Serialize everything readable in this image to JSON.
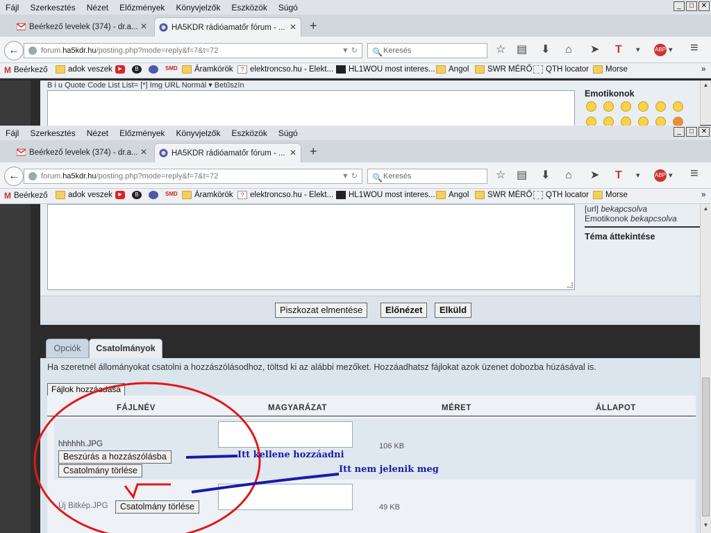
{
  "menubar": {
    "items": [
      "Fájl",
      "Szerkesztés",
      "Nézet",
      "Előzmények",
      "Könyvjelzők",
      "Eszközök",
      "Súgó"
    ]
  },
  "window_controls": [
    "_",
    "□",
    "✕"
  ],
  "tabs": [
    {
      "label": "Beérkező levelek (374) - dr.a...",
      "icon": "gmail-icon"
    },
    {
      "label": "HA5KDR rádióamatőr fórum - ...",
      "icon": "ha5kdr-icon"
    }
  ],
  "tab_close": "✕",
  "new_tab": "+",
  "nav": {
    "back": "←",
    "url_domain": "ha5kdr.hu",
    "url_prefix": "forum.",
    "url_path": "/posting.php?mode=reply&f=7&t=72",
    "search_placeholder": "Keresés",
    "url_arrows": "▼ ↻",
    "search_glyph": "🔍"
  },
  "toolbar_icons": {
    "star": "☆",
    "reader": "▤",
    "download": "⬇",
    "home": "⌂",
    "send": "➤",
    "t": "T",
    "t_arrow": "▾",
    "abp": "ABP",
    "abp_arrow": "▾",
    "menu": "≡"
  },
  "bookmarks": [
    {
      "label": "Beérkező",
      "icon": "gmail"
    },
    {
      "label": "adok veszek",
      "icon": "folder"
    },
    {
      "label": "",
      "icon": "youtube"
    },
    {
      "label": "",
      "icon": "b"
    },
    {
      "label": "",
      "icon": "ha5kdr"
    },
    {
      "label": "",
      "icon": "smd"
    },
    {
      "label": "Áramkörök",
      "icon": "folder"
    },
    {
      "label": "elektroncso.hu - Elekt...",
      "icon": "page"
    },
    {
      "label": "HL1WOU most interes...",
      "icon": "film"
    },
    {
      "label": "Angol",
      "icon": "folder"
    },
    {
      "label": "SWR MÉRŐ",
      "icon": "folder"
    },
    {
      "label": "QTH locator",
      "icon": "blank"
    },
    {
      "label": "Morse",
      "icon": "folder"
    }
  ],
  "bookmarks_more": "»",
  "bookmark_glyphs": {
    "gmail": "M",
    "youtube": "▶",
    "b": "B",
    "smd": "SMD",
    "page": "?"
  },
  "upper_editor": {
    "toolbar": "B  i  u  Quote  Code  List  List=  [*]  Img  URL  Normál ▾  Betűszín",
    "emoticons_title": "Emotikonok"
  },
  "sidebar": {
    "url_prefix": "[url] ",
    "url_status": "bekapcsolva",
    "emoti_prefix": "Emotikonok ",
    "emoti_status": "bekapcsolva",
    "topic_overview": "Téma áttekintése"
  },
  "buttons": {
    "draft": "Piszkozat elmentése",
    "preview": "Előnézet",
    "submit": "Elküld"
  },
  "tabs2": {
    "options": "Opciók",
    "attachments": "Csatolmányok"
  },
  "attach": {
    "hint": "Ha szeretnél állományokat csatolni a hozzászólásodhoz, töltsd ki az alábbi mezőket. Hozzáadhatsz fájlokat azok üzenet dobozba húzásával is.",
    "add_files": "Fájlok hozzáadása",
    "headers": [
      "FÁJLNÉV",
      "MAGYARÁZAT",
      "MÉRET",
      "ÁLLAPOT"
    ],
    "rows": [
      {
        "filename": "hhhhhh.JPG",
        "size": "106 KB",
        "insert": "Beszúrás a hozzászólásba",
        "delete": "Csatolmány törlése"
      },
      {
        "filename": "Új Bitkép.JPG",
        "size": "49 KB",
        "delete": "Csatolmány törlése"
      }
    ]
  },
  "annotations": {
    "a1": "Itt kellene hozzáadni",
    "a2": "Itt nem jelenik meg"
  },
  "scroll_arrows": {
    "up": "▲",
    "down": "▼"
  },
  "colors": {
    "annotation_red": "#e01818",
    "annotation_blue": "#1a1aa8"
  }
}
